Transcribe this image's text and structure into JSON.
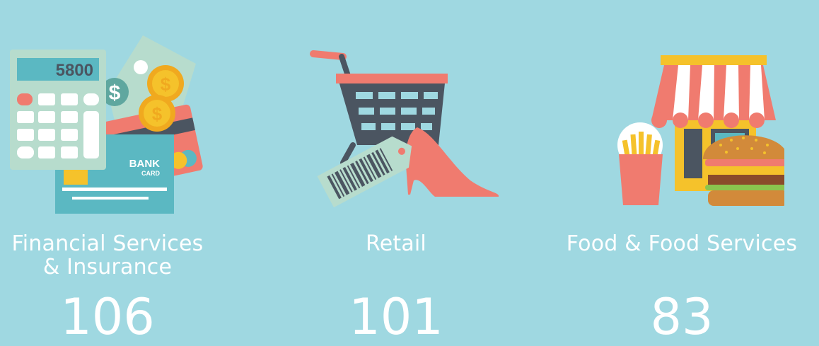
{
  "categories": [
    {
      "label_line1": "Financial Services",
      "label_line2": "& Insurance",
      "count": "106",
      "icon": "calculator-bank-card-coins-icon",
      "calculator_display": "5800",
      "card_text_main": "BANK",
      "card_text_sub": "CARD"
    },
    {
      "label_line1": "Retail",
      "count": "101",
      "icon": "shopping-cart-shoe-tag-icon"
    },
    {
      "label_line1": "Food & Food Services",
      "count": "83",
      "icon": "storefront-fries-burger-icon"
    }
  ],
  "colors": {
    "background": "#9fd8e1",
    "text": "#ffffff",
    "coral": "#f07b6f",
    "teal": "#5bb8c2",
    "dark": "#4b5561",
    "gold": "#f5c22b"
  }
}
